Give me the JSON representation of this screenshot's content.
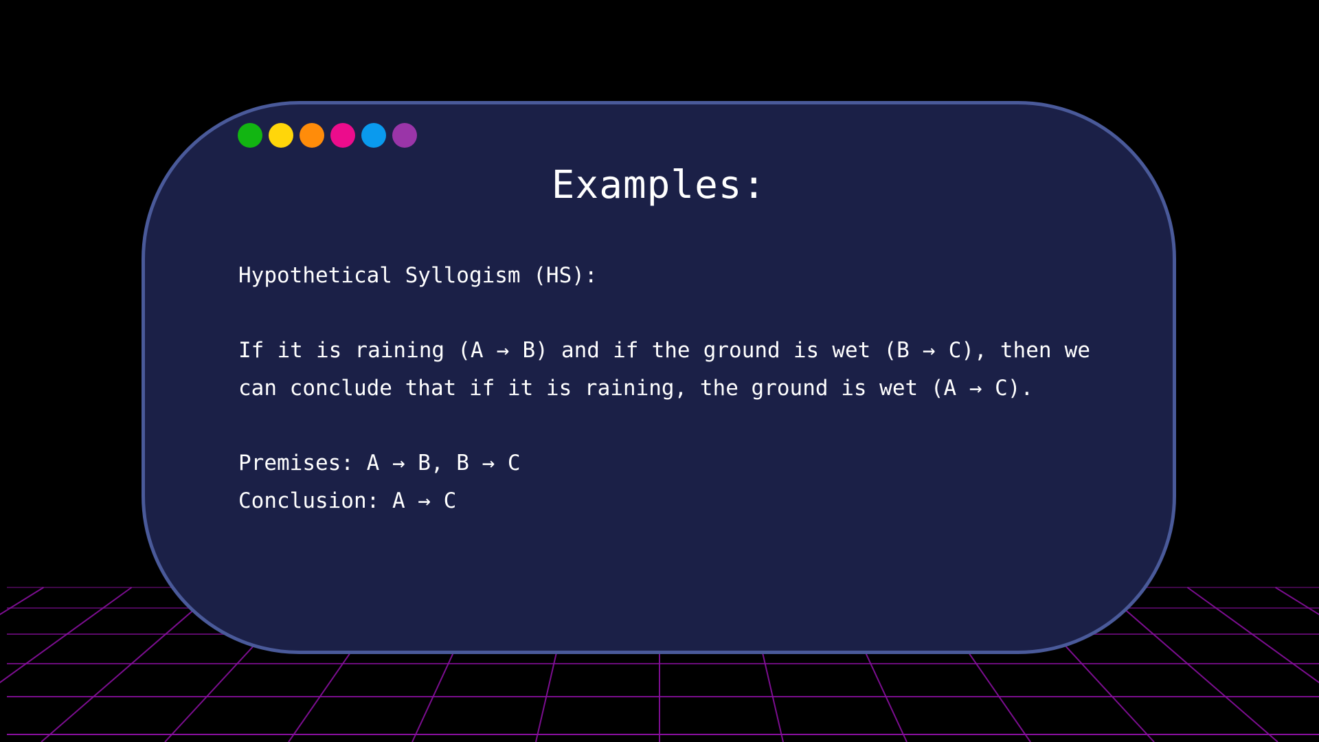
{
  "card": {
    "title": "Examples:",
    "window_dots": [
      {
        "name": "green-dot",
        "color": "#12b512"
      },
      {
        "name": "yellow-dot",
        "color": "#ffd60a"
      },
      {
        "name": "orange-dot",
        "color": "#ff8c0a"
      },
      {
        "name": "pink-dot",
        "color": "#ec0c8c"
      },
      {
        "name": "blue-dot",
        "color": "#0a9aee"
      },
      {
        "name": "purple-dot",
        "color": "#9a35a8"
      }
    ],
    "heading": "Hypothetical Syllogism (HS):",
    "paragraph": "If it is raining (A → B) and if the ground is wet (B → C), then we can conclude that if it is raining, the ground is wet (A → C).",
    "premises": "Premises: A → B, B → C",
    "conclusion": "Conclusion: A → C"
  },
  "colors": {
    "background": "#000000",
    "card_fill": "#1b2047",
    "card_border": "#4a5a9a",
    "grid": "#8a0fa0",
    "text": "#ffffff"
  }
}
